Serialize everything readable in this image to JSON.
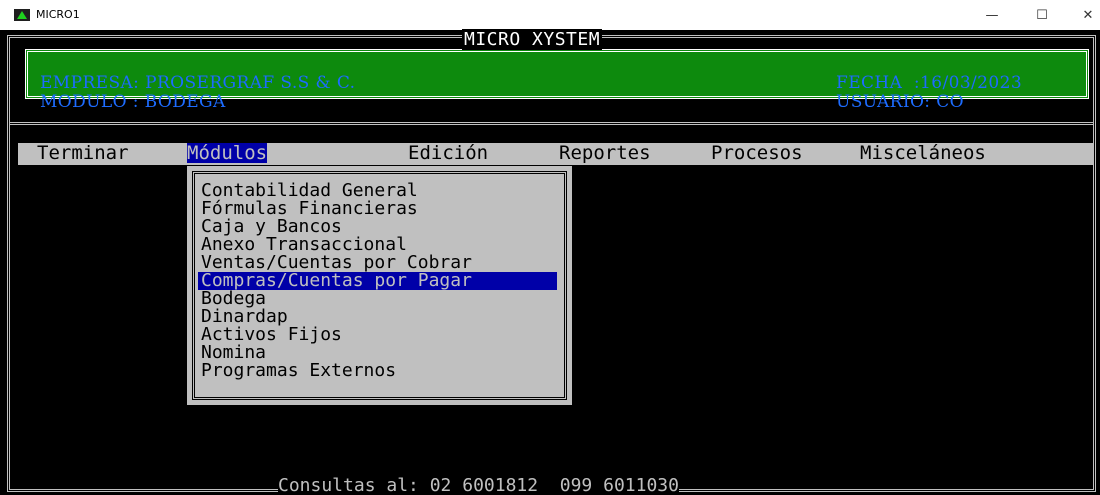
{
  "window": {
    "title": "MICRO1",
    "minimize_glyph": "—",
    "maximize_glyph": "☐",
    "close_glyph": "✕"
  },
  "header": {
    "system_title": "MICRO XYSTEM",
    "empresa": "EMPRESA: PROSERGRAF S.S & C.",
    "modulo": "MODULO : BODEGA",
    "fecha": "FECHA  :16/03/2023",
    "usuario": "USUARIO: CO"
  },
  "menubar": {
    "items": [
      "Terminar",
      "Módulos",
      "Edición",
      "Reportes",
      "Procesos",
      "Misceláneos"
    ],
    "active_index": 1
  },
  "dropdown": {
    "items": [
      "Contabilidad General",
      "Fórmulas Financieras",
      "Caja y Bancos",
      "Anexo Transaccional",
      "Ventas/Cuentas por Cobrar",
      "Compras/Cuentas por Pagar",
      "Bodega",
      "Dinardap",
      "Activos Fijos",
      "Nomina",
      "Programas Externos"
    ],
    "selected_index": 5
  },
  "footer": {
    "text": "Consultas al: 02 6001812  099 6011030"
  },
  "colors": {
    "header_bg": "#0d8a0d",
    "header_text": "#1d6cff",
    "menu_bg": "#c0c0c0",
    "highlight_bg": "#0000a8",
    "console_bg": "#000000"
  },
  "icons": {
    "app": "green-triangle-app-icon"
  }
}
